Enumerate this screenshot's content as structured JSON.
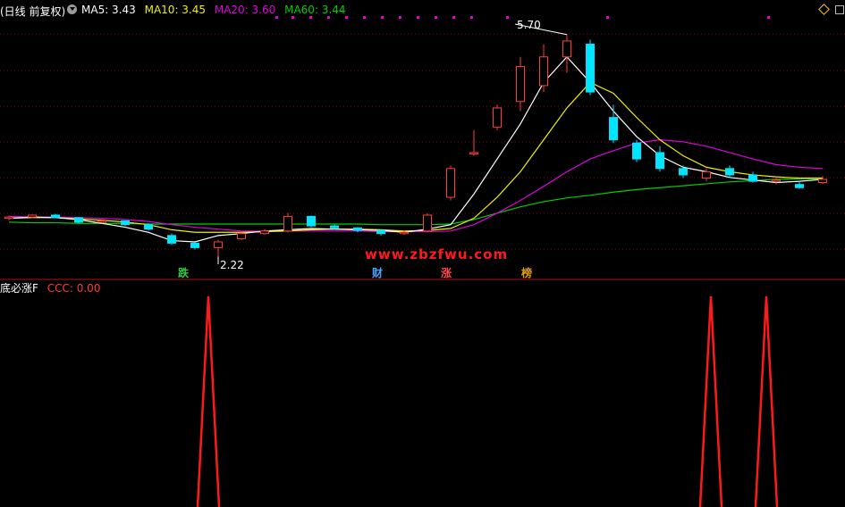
{
  "header": {
    "title": "(日线 前复权)",
    "ma5_label": "MA5: 3.43",
    "ma10_label": "MA10: 3.45",
    "ma20_label": "MA20: 3.60",
    "ma60_label": "MA60: 3.44",
    "toggle_icon": "circle-chevron-icon",
    "right_icons": [
      "diamond-icon",
      "square-icon"
    ]
  },
  "indicator": {
    "name": "底必涨F",
    "value_label": "CCC: 0.00"
  },
  "annotations": {
    "high_label": "5.70",
    "low_label": "2.22",
    "signals": [
      {
        "text": "跌",
        "color": "#2ecc40"
      },
      {
        "text": "财",
        "color": "#4aa3ff"
      },
      {
        "text": "涨",
        "color": "#ff4a4a"
      },
      {
        "text": "榜",
        "color": "#e8a000"
      }
    ],
    "watermark": "www.zbzfwu.com"
  },
  "colors": {
    "background": "#000000",
    "up": "#ff3b3b",
    "down": "#00e5ff",
    "ma5": "#ffffff",
    "ma10": "#f0f000",
    "ma20": "#e000e0",
    "ma60": "#00d000",
    "grid": "#7a1010",
    "signal": "#ff1a1a"
  },
  "chart_data": [
    {
      "type": "candlestick",
      "title": "(日线 前复权)",
      "ylim": [
        2.0,
        6.0
      ],
      "series": [
        {
          "name": "MA5",
          "values": [
            2.82,
            2.84,
            2.83,
            2.8,
            2.74,
            2.68,
            2.6,
            2.47,
            2.45,
            2.55,
            2.58,
            2.62,
            2.64,
            2.66,
            2.65,
            2.64,
            2.63,
            2.6,
            2.65,
            2.72,
            3.2,
            3.75,
            4.3,
            4.95,
            5.35,
            4.95,
            4.5,
            4.1,
            3.8,
            3.62,
            3.55,
            3.46,
            3.42,
            3.38,
            3.4,
            3.43
          ]
        },
        {
          "name": "MA10",
          "values": [
            2.82,
            2.83,
            2.83,
            2.81,
            2.79,
            2.76,
            2.72,
            2.64,
            2.6,
            2.6,
            2.6,
            2.61,
            2.62,
            2.64,
            2.65,
            2.65,
            2.64,
            2.62,
            2.63,
            2.66,
            2.82,
            3.15,
            3.55,
            4.05,
            4.55,
            4.95,
            4.78,
            4.4,
            4.05,
            3.8,
            3.62,
            3.55,
            3.5,
            3.47,
            3.45,
            3.45
          ]
        },
        {
          "name": "MA20",
          "values": [
            2.85,
            2.84,
            2.84,
            2.83,
            2.82,
            2.8,
            2.77,
            2.72,
            2.68,
            2.65,
            2.62,
            2.62,
            2.62,
            2.62,
            2.62,
            2.62,
            2.61,
            2.61,
            2.61,
            2.62,
            2.72,
            2.9,
            3.1,
            3.32,
            3.55,
            3.75,
            3.88,
            4.0,
            4.05,
            4.02,
            3.95,
            3.85,
            3.75,
            3.66,
            3.62,
            3.6
          ]
        },
        {
          "name": "MA60",
          "values": [
            2.76,
            2.75,
            2.75,
            2.74,
            2.74,
            2.74,
            2.73,
            2.73,
            2.73,
            2.73,
            2.73,
            2.73,
            2.73,
            2.73,
            2.73,
            2.73,
            2.72,
            2.72,
            2.72,
            2.73,
            2.8,
            2.9,
            3.0,
            3.08,
            3.14,
            3.18,
            3.23,
            3.27,
            3.3,
            3.33,
            3.36,
            3.39,
            3.41,
            3.43,
            3.44,
            3.44
          ]
        }
      ],
      "candles": [
        {
          "o": 2.82,
          "h": 2.86,
          "l": 2.79,
          "c": 2.84
        },
        {
          "o": 2.84,
          "h": 2.88,
          "l": 2.82,
          "c": 2.87
        },
        {
          "o": 2.87,
          "h": 2.89,
          "l": 2.82,
          "c": 2.83
        },
        {
          "o": 2.83,
          "h": 2.84,
          "l": 2.74,
          "c": 2.76
        },
        {
          "o": 2.76,
          "h": 2.8,
          "l": 2.74,
          "c": 2.78
        },
        {
          "o": 2.78,
          "h": 2.79,
          "l": 2.7,
          "c": 2.72
        },
        {
          "o": 2.72,
          "h": 2.74,
          "l": 2.63,
          "c": 2.65
        },
        {
          "o": 2.55,
          "h": 2.58,
          "l": 2.4,
          "c": 2.43
        },
        {
          "o": 2.43,
          "h": 2.44,
          "l": 2.33,
          "c": 2.36
        },
        {
          "o": 2.36,
          "h": 2.48,
          "l": 2.22,
          "c": 2.45
        },
        {
          "o": 2.5,
          "h": 2.6,
          "l": 2.48,
          "c": 2.58
        },
        {
          "o": 2.58,
          "h": 2.65,
          "l": 2.56,
          "c": 2.62
        },
        {
          "o": 2.62,
          "h": 2.9,
          "l": 2.6,
          "c": 2.85
        },
        {
          "o": 2.85,
          "h": 2.86,
          "l": 2.68,
          "c": 2.7
        },
        {
          "o": 2.7,
          "h": 2.72,
          "l": 2.64,
          "c": 2.67
        },
        {
          "o": 2.67,
          "h": 2.68,
          "l": 2.6,
          "c": 2.63
        },
        {
          "o": 2.63,
          "h": 2.64,
          "l": 2.55,
          "c": 2.58
        },
        {
          "o": 2.58,
          "h": 2.63,
          "l": 2.56,
          "c": 2.6
        },
        {
          "o": 2.62,
          "h": 2.9,
          "l": 2.6,
          "c": 2.87
        },
        {
          "o": 3.15,
          "h": 3.65,
          "l": 3.1,
          "c": 3.6
        },
        {
          "o": 3.85,
          "h": 4.2,
          "l": 3.8,
          "c": 3.85
        },
        {
          "o": 4.25,
          "h": 4.6,
          "l": 4.2,
          "c": 4.55
        },
        {
          "o": 4.65,
          "h": 5.35,
          "l": 4.5,
          "c": 5.2
        },
        {
          "o": 4.9,
          "h": 5.55,
          "l": 4.8,
          "c": 5.35
        },
        {
          "o": 5.35,
          "h": 5.7,
          "l": 5.1,
          "c": 5.6
        },
        {
          "o": 5.55,
          "h": 5.62,
          "l": 4.75,
          "c": 4.8
        },
        {
          "o": 4.4,
          "h": 4.6,
          "l": 4.0,
          "c": 4.05
        },
        {
          "o": 4.0,
          "h": 4.05,
          "l": 3.7,
          "c": 3.75
        },
        {
          "o": 3.85,
          "h": 3.95,
          "l": 3.55,
          "c": 3.6
        },
        {
          "o": 3.6,
          "h": 3.65,
          "l": 3.45,
          "c": 3.5
        },
        {
          "o": 3.45,
          "h": 3.6,
          "l": 3.4,
          "c": 3.55
        },
        {
          "o": 3.6,
          "h": 3.65,
          "l": 3.45,
          "c": 3.5
        },
        {
          "o": 3.5,
          "h": 3.55,
          "l": 3.38,
          "c": 3.4
        },
        {
          "o": 3.4,
          "h": 3.45,
          "l": 3.35,
          "c": 3.42
        },
        {
          "o": 3.35,
          "h": 3.4,
          "l": 3.28,
          "c": 3.3
        },
        {
          "o": 3.38,
          "h": 3.48,
          "l": 3.36,
          "c": 3.43
        }
      ],
      "markers": {
        "high": 5.7,
        "low": 2.22
      }
    },
    {
      "type": "line",
      "title": "底必涨F",
      "series": [
        {
          "name": "CCC",
          "values": [
            0,
            0,
            0,
            0,
            0,
            0,
            0,
            0,
            1,
            0,
            0,
            0,
            0,
            0,
            0,
            0,
            0,
            0,
            0,
            0,
            0,
            0,
            0,
            0,
            0,
            0,
            0,
            0,
            0,
            0,
            0,
            0,
            1,
            0,
            1,
            0,
            0
          ]
        }
      ],
      "ylim": [
        0,
        1
      ]
    }
  ]
}
